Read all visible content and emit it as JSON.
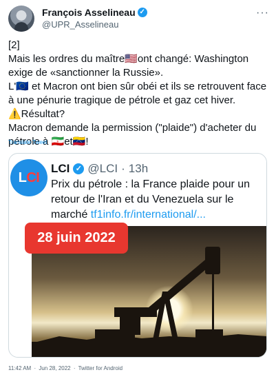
{
  "author": {
    "display_name": "François Asselineau",
    "handle": "@UPR_Asselineau",
    "verified_symbol": "✓"
  },
  "header": {
    "more_icon": "···"
  },
  "tweet": {
    "text": "[2]\nMais les ordres du maître🇺🇸ont changé: Washington exige de «sanctionner la Russie».\nL'🇪🇺 et Macron ont bien sûr obéi et ils se retrouvent face à une pénurie tragique de pétrole et gaz cet hiver.\n⚠️Résultat?\nMacron demande la permission (\"plaide\") d'acheter du pétrole à 🇮🇷et🇻🇪!",
    "translate_label": "Translate Tweet"
  },
  "quoted_tweet": {
    "logo_l": "L",
    "logo_ci": "CI",
    "display_name": "LCI",
    "verified_symbol": "✓",
    "handle": "@LCI",
    "separator": "·",
    "time": "13h",
    "text": "Prix du pétrole : la France plaide pour un retour de l'Iran et du Venezuela sur le marché ",
    "link": "tf1info.fr/international/...",
    "media_badge": "28 juin 2022"
  },
  "meta": {
    "time": "11:42 AM",
    "separator": "·",
    "date": "Jun 28, 2022",
    "source": "Twitter for Android"
  },
  "colors": {
    "accent": "#1d9bf0",
    "text": "#0f1419",
    "muted": "#536471",
    "badge_red": "#e8372f",
    "lci_blue": "#1f8fe6"
  }
}
